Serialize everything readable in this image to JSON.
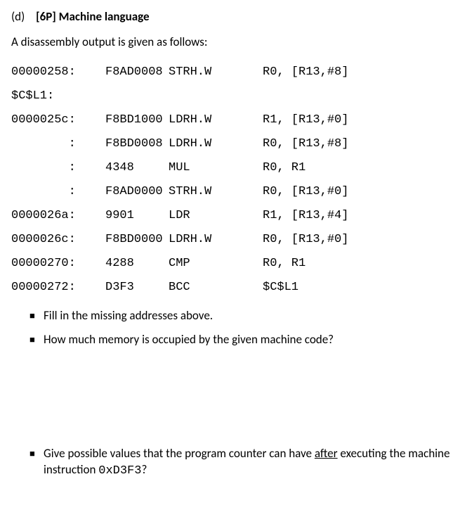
{
  "heading": {
    "part": "(d)",
    "tag": "[6P]",
    "title": "Machine language"
  },
  "intro": "A disassembly output is given as follows:",
  "listing": {
    "rows": [
      {
        "addr": "00000258:",
        "opcode": "F8AD0008",
        "mnemonic": "STRH.W",
        "operands": "R0, [R13,#8]"
      }
    ],
    "label": "$C$L1:",
    "rows2": [
      {
        "addr": "0000025c:",
        "opcode": "F8BD1000",
        "mnemonic": "LDRH.W",
        "operands": "R1, [R13,#0]"
      },
      {
        "addr": "        :",
        "opcode": "F8BD0008",
        "mnemonic": "LDRH.W",
        "operands": "R0, [R13,#8]"
      },
      {
        "addr": "        :",
        "opcode": "4348",
        "mnemonic": "MUL",
        "operands": "R0, R1"
      },
      {
        "addr": "        :",
        "opcode": "F8AD0000",
        "mnemonic": "STRH.W",
        "operands": "R0, [R13,#0]"
      },
      {
        "addr": "0000026a:",
        "opcode": "9901",
        "mnemonic": "LDR",
        "operands": "R1, [R13,#4]"
      },
      {
        "addr": "0000026c:",
        "opcode": "F8BD0000",
        "mnemonic": "LDRH.W",
        "operands": "R0, [R13,#0]"
      },
      {
        "addr": "00000270:",
        "opcode": "4288",
        "mnemonic": "CMP",
        "operands": "R0, R1"
      },
      {
        "addr": "00000272:",
        "opcode": "D3F3",
        "mnemonic": "BCC",
        "operands": "$C$L1"
      }
    ]
  },
  "bullet": "■",
  "q1": "Fill in the missing addresses above.",
  "q2": "How much memory is occupied by the given machine code?",
  "q3_a": "Give possible values that the program counter can have ",
  "q3_u": "after",
  "q3_b": " executing the machine instruction ",
  "q3_code": "0xD3F3",
  "q3_c": "?"
}
